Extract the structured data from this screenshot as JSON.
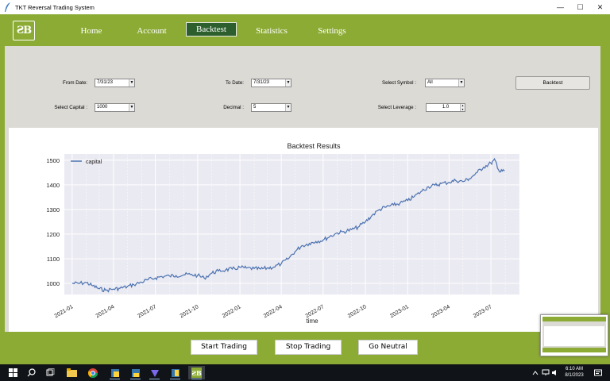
{
  "window": {
    "title": "TKT Reversal Trading System",
    "controls": {
      "minimize": "—",
      "maximize": "☐",
      "close": "✕"
    }
  },
  "logo": {
    "text": "ƧB"
  },
  "nav": {
    "items": [
      {
        "label": "Home",
        "active": false
      },
      {
        "label": "Account",
        "active": false
      },
      {
        "label": "Backtest",
        "active": true
      },
      {
        "label": "Statistics",
        "active": false
      },
      {
        "label": "Settings",
        "active": false
      }
    ]
  },
  "form": {
    "from_date": {
      "label": "From Date:",
      "value": "7/31/23"
    },
    "to_date": {
      "label": "To Date:",
      "value": "7/31/23"
    },
    "symbol": {
      "label": "Select Symbol :",
      "value": "All"
    },
    "capital": {
      "label": "Select Capital :",
      "value": "1000"
    },
    "decimal": {
      "label": "Decimal :",
      "value": "5"
    },
    "leverage": {
      "label": "Select Leverage :",
      "value": "1.0"
    },
    "backtest_button": "Backtest"
  },
  "chart_data": {
    "type": "line",
    "title": "Backtest Results",
    "xlabel": "time",
    "ylabel": "",
    "legend": "top-left",
    "grid": true,
    "x_ticks": [
      "2021-01",
      "2021-04",
      "2021-07",
      "2021-10",
      "2022-01",
      "2022-04",
      "2022-07",
      "2022-10",
      "2023-01",
      "2023-04",
      "2023-07"
    ],
    "y_ticks": [
      1000,
      1100,
      1200,
      1300,
      1400,
      1500
    ],
    "ylim": [
      955,
      1525
    ],
    "series": [
      {
        "name": "capital",
        "color": "#4c72b0",
        "x": [
          "2021-01-01",
          "2021-01-15",
          "2021-02-01",
          "2021-02-15",
          "2021-03-01",
          "2021-03-15",
          "2021-04-01",
          "2021-04-15",
          "2021-05-01",
          "2021-05-15",
          "2021-06-01",
          "2021-06-15",
          "2021-07-01",
          "2021-07-15",
          "2021-08-01",
          "2021-08-15",
          "2021-09-01",
          "2021-09-15",
          "2021-10-01",
          "2021-10-15",
          "2021-11-01",
          "2021-11-15",
          "2021-12-01",
          "2021-12-15",
          "2022-01-01",
          "2022-01-15",
          "2022-02-01",
          "2022-02-15",
          "2022-03-01",
          "2022-03-15",
          "2022-04-01",
          "2022-04-15",
          "2022-05-01",
          "2022-05-15",
          "2022-06-01",
          "2022-06-15",
          "2022-07-01",
          "2022-07-15",
          "2022-08-01",
          "2022-08-15",
          "2022-09-01",
          "2022-09-15",
          "2022-10-01",
          "2022-10-15",
          "2022-11-01",
          "2022-11-15",
          "2022-12-01",
          "2022-12-15",
          "2023-01-01",
          "2023-01-15",
          "2023-02-01",
          "2023-02-15",
          "2023-03-01",
          "2023-03-15",
          "2023-04-01",
          "2023-04-15",
          "2023-05-01",
          "2023-05-15",
          "2023-06-01",
          "2023-06-15",
          "2023-07-01",
          "2023-07-10",
          "2023-07-20",
          "2023-07-31"
        ],
        "values": [
          1000,
          1000,
          1003,
          990,
          978,
          972,
          977,
          980,
          987,
          995,
          1005,
          1015,
          1022,
          1028,
          1030,
          1032,
          1035,
          1036,
          1032,
          1022,
          1042,
          1050,
          1055,
          1058,
          1065,
          1062,
          1060,
          1058,
          1062,
          1066,
          1080,
          1098,
          1130,
          1152,
          1162,
          1170,
          1176,
          1190,
          1205,
          1210,
          1218,
          1228,
          1250,
          1275,
          1300,
          1310,
          1318,
          1325,
          1336,
          1352,
          1375,
          1392,
          1398,
          1405,
          1410,
          1418,
          1413,
          1425,
          1450,
          1472,
          1488,
          1500,
          1452,
          1458
        ]
      }
    ]
  },
  "actions": {
    "start_trading": "Start Trading",
    "stop_trading": "Stop Trading",
    "go_neutral": "Go Neutral"
  },
  "taskbar": {
    "time": "6:10 AM",
    "date": "8/1/2023"
  }
}
